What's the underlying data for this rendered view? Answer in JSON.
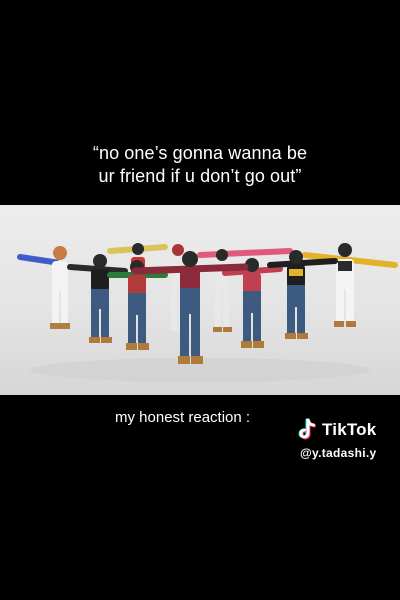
{
  "caption_top": {
    "line1": "“no one’s gonna wanna be",
    "line2": "ur friend if u don’t go out”"
  },
  "caption_bottom": "my honest reaction :",
  "watermark": {
    "icon": "tiktok-note-icon",
    "brand": "TikTok",
    "handle": "@y.tadashi.y"
  },
  "video": {
    "description_icon": "dance-video-frame",
    "colors": {
      "backdrop": "#e9e9e9",
      "floor": "#dcdcdc",
      "denim": "#3d5a80",
      "boots": "#b07a3a"
    }
  }
}
